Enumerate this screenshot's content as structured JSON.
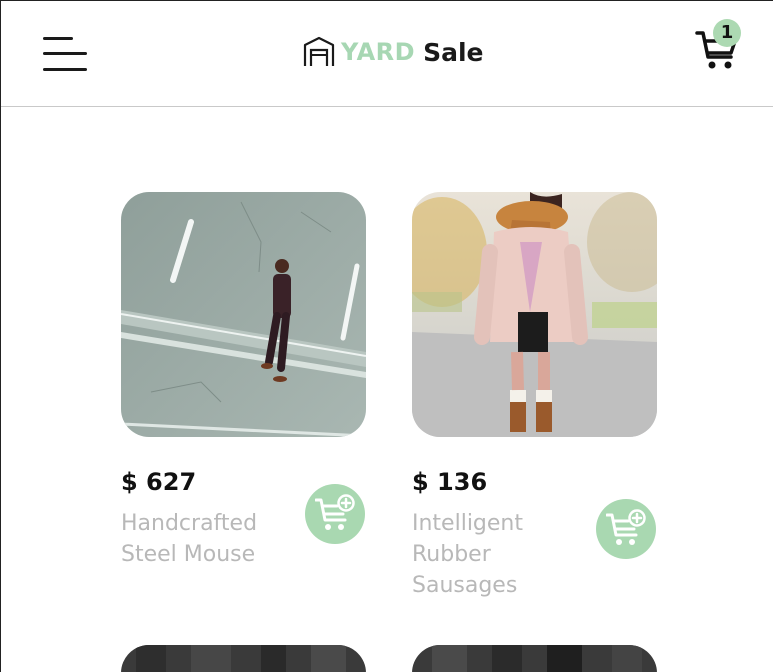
{
  "header": {
    "logo_primary": "YARD",
    "logo_secondary": "Sale",
    "cart_count": "1"
  },
  "products": [
    {
      "price": "$ 627",
      "name": "Handcrafted Steel Mouse",
      "image": "man-walking-on-street-photo"
    },
    {
      "price": "$ 136",
      "name": "Intelligent Rubber Sausages",
      "image": "woman-in-pink-coat-photo"
    }
  ],
  "colors": {
    "accent_green": "#a9d8b1",
    "text_dark": "#111111",
    "text_muted": "#b8b8b8",
    "divider": "#c9c9c9"
  },
  "icons": {
    "menu": "hamburger-menu-icon",
    "cart": "shopping-cart-icon",
    "add_to_cart": "cart-plus-icon",
    "logo": "garage-icon"
  }
}
